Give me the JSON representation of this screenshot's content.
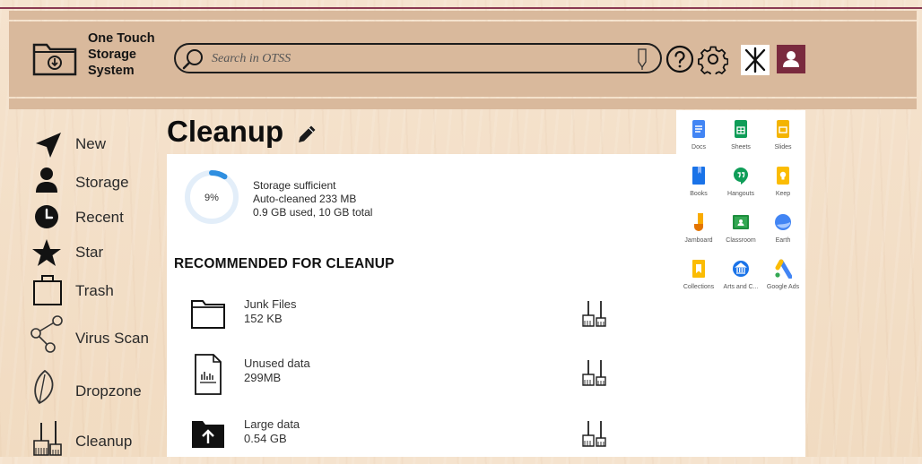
{
  "header": {
    "brand_lines": [
      "One Touch",
      "Storage",
      "System"
    ],
    "search_placeholder": "Search in OTSS"
  },
  "sidebar": {
    "items": [
      {
        "label": "New",
        "icon": "paper-plane-icon"
      },
      {
        "label": "Storage",
        "icon": "person-icon"
      },
      {
        "label": "Recent",
        "icon": "clock-icon"
      },
      {
        "label": "Star",
        "icon": "star-icon"
      },
      {
        "label": "Trash",
        "icon": "trash-bin-icon"
      },
      {
        "label": "Virus Scan",
        "icon": "share-nodes-icon"
      },
      {
        "label": "Dropzone",
        "icon": "leaf-icon"
      },
      {
        "label": "Cleanup",
        "icon": "broom-icon"
      }
    ]
  },
  "main": {
    "title": "Cleanup",
    "storage": {
      "percent_label": "9%",
      "percent_value": 9,
      "status": "Storage sufficient",
      "auto_cleaned": "Auto-cleaned 233 MB",
      "usage": "0.9 GB used, 10 GB total"
    },
    "recommended_title": "RECOMMENDED FOR CLEANUP",
    "items": [
      {
        "name": "Junk Files",
        "size": "152 KB",
        "icon": "folder-icon"
      },
      {
        "name": "Unused data",
        "size": "299MB",
        "icon": "chart-document-icon"
      },
      {
        "name": "Large data",
        "size": "0.54 GB",
        "icon": "upload-folder-icon"
      }
    ]
  },
  "apps": [
    {
      "label": "Docs",
      "color": "#4285f4",
      "icon": "docs-icon"
    },
    {
      "label": "Sheets",
      "color": "#0f9d58",
      "icon": "sheets-icon"
    },
    {
      "label": "Slides",
      "color": "#f4b400",
      "icon": "slides-icon"
    },
    {
      "label": "Books",
      "color": "#1a73e8",
      "icon": "books-icon"
    },
    {
      "label": "Hangouts",
      "color": "#0f9d58",
      "icon": "hangouts-icon"
    },
    {
      "label": "Keep",
      "color": "#fbbc04",
      "icon": "keep-icon"
    },
    {
      "label": "Jamboard",
      "color": "#f9ab00",
      "icon": "jamboard-icon"
    },
    {
      "label": "Classroom",
      "color": "#1e8e3e",
      "icon": "classroom-icon"
    },
    {
      "label": "Earth",
      "color": "#4285f4",
      "icon": "earth-icon"
    },
    {
      "label": "Collections",
      "color": "#fbbc04",
      "icon": "collections-icon"
    },
    {
      "label": "Arts and C...",
      "color": "#1a73e8",
      "icon": "arts-culture-icon"
    },
    {
      "label": "Google Ads",
      "color": "#4285f4",
      "icon": "google-ads-icon"
    }
  ],
  "colors": {
    "header_bg": "#d9b99c",
    "accent": "#7a2a3e",
    "ring": "#2f8fe0"
  }
}
